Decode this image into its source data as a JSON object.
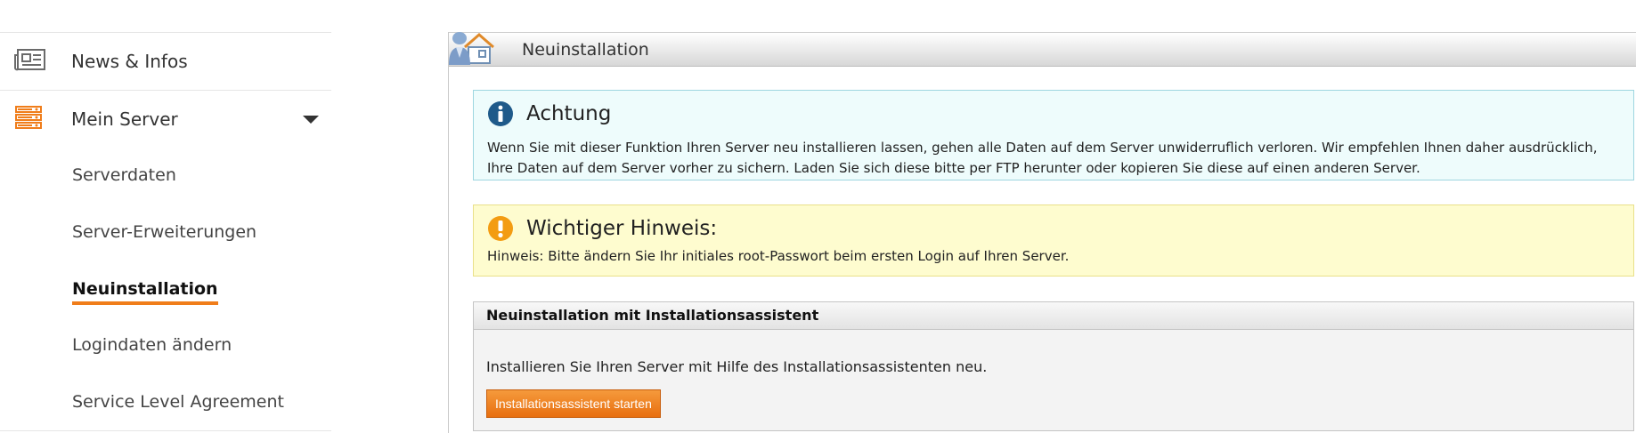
{
  "sidebar": {
    "items": [
      {
        "label": "News & Infos",
        "icon": "newspaper-icon"
      },
      {
        "label": "Mein Server",
        "icon": "server-icon",
        "expanded": true
      }
    ],
    "subitems": [
      {
        "label": "Serverdaten"
      },
      {
        "label": "Server-Erweiterungen"
      },
      {
        "label": "Neuinstallation",
        "active": true
      },
      {
        "label": "Logindaten ändern"
      },
      {
        "label": "Service Level Agreement"
      }
    ]
  },
  "page": {
    "title": "Neuinstallation",
    "title_icon": "house-user-icon"
  },
  "info_box": {
    "icon": "info-icon",
    "title": "Achtung",
    "text": "Wenn Sie mit dieser Funktion Ihren Server neu installieren lassen, gehen alle Daten auf dem Server unwiderruflich verloren. Wir empfehlen Ihnen daher ausdrücklich, Ihre Daten auf dem Server vorher zu sichern. Laden Sie sich diese bitte per FTP herunter oder kopieren Sie diese auf einen anderen Server."
  },
  "warning_box": {
    "icon": "exclamation-icon",
    "title": "Wichtiger Hinweis:",
    "text": "Hinweis: Bitte ändern Sie Ihr initiales root-Passwort beim ersten Login auf Ihren Server."
  },
  "wizard": {
    "header": "Neuinstallation mit Installationsassistent",
    "description": "Installieren Sie Ihren Server mit Hilfe des Installationsassistenten neu.",
    "button_label": "Installationsassistent starten"
  },
  "colors": {
    "accent": "#f07d1a",
    "info_bg": "#eefcfc",
    "warning_bg": "#fefccf",
    "info_icon": "#1f5a8a",
    "warning_icon": "#f39c12"
  }
}
